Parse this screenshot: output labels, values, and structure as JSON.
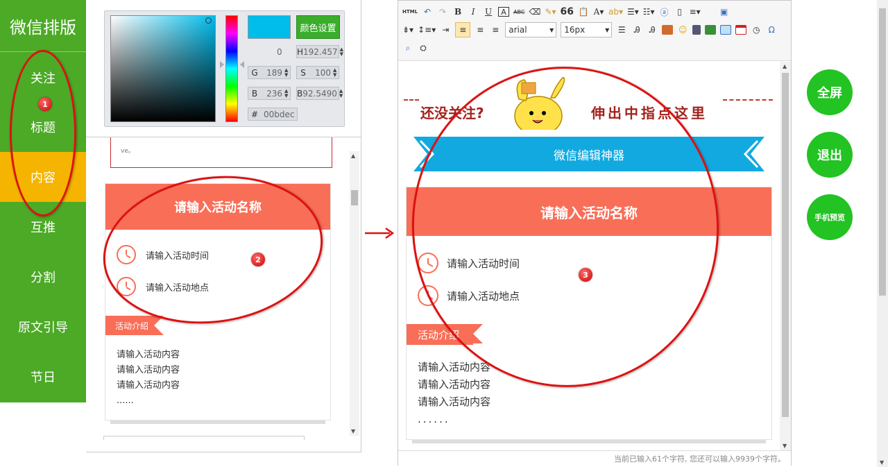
{
  "sidebar": {
    "logo": "微信排版",
    "items": [
      {
        "label": "关注"
      },
      {
        "label": "标题"
      },
      {
        "label": "内容"
      },
      {
        "label": "互推"
      },
      {
        "label": "分割"
      },
      {
        "label": "原文引导"
      },
      {
        "label": "节日"
      }
    ],
    "active_item": "内容",
    "colors": {
      "bg": "#4caa26",
      "active": "#f5b400"
    }
  },
  "color_picker": {
    "selected_color": "#00bdec",
    "set_color_button": "颜色设置",
    "left_value": "0",
    "h_value": "192.457",
    "g_value": "189",
    "s_value": "100",
    "b_value": "236",
    "b2_value": "92.5490",
    "hex_value": "00bdec",
    "labels": {
      "h": "H",
      "g": "G",
      "s": "S",
      "b": "B",
      "b2": "B",
      "hex": "#"
    }
  },
  "preview": {
    "top_box_text": "ve。",
    "card": {
      "title": "请输入活动名称",
      "time": "请输入活动时间",
      "place": "请输入活动地点",
      "intro_label": "活动介绍",
      "content_lines": [
        "请输入活动内容",
        "请输入活动内容",
        "请输入活动内容",
        "......"
      ]
    }
  },
  "editor": {
    "toolbar": {
      "html_label": "HTML",
      "font_family": "arial",
      "font_size": "16px",
      "text_items": [
        "B",
        "I",
        "U",
        "A",
        "ABC",
        "66",
        "A",
        "Ω"
      ]
    },
    "follow_banner": {
      "left_text": "还没关注?",
      "right_text": "伸出中指点这里"
    },
    "blue_banner_title": "微信编辑神器",
    "card": {
      "title": "请输入活动名称",
      "time": "请输入活动时间",
      "place": "请输入活动地点",
      "intro_label": "活动介绍",
      "content_lines": [
        "请输入活动内容",
        "请输入活动内容",
        "请输入活动内容",
        "......"
      ]
    },
    "status_bar": "当前已输入61个字符, 您还可以输入9939个字符。"
  },
  "right_buttons": {
    "fullscreen": "全屏",
    "exit": "退出",
    "mobile_preview": "手机预览"
  },
  "annotations": {
    "badges": [
      "1",
      "2",
      "3"
    ],
    "color": "#d11111"
  }
}
